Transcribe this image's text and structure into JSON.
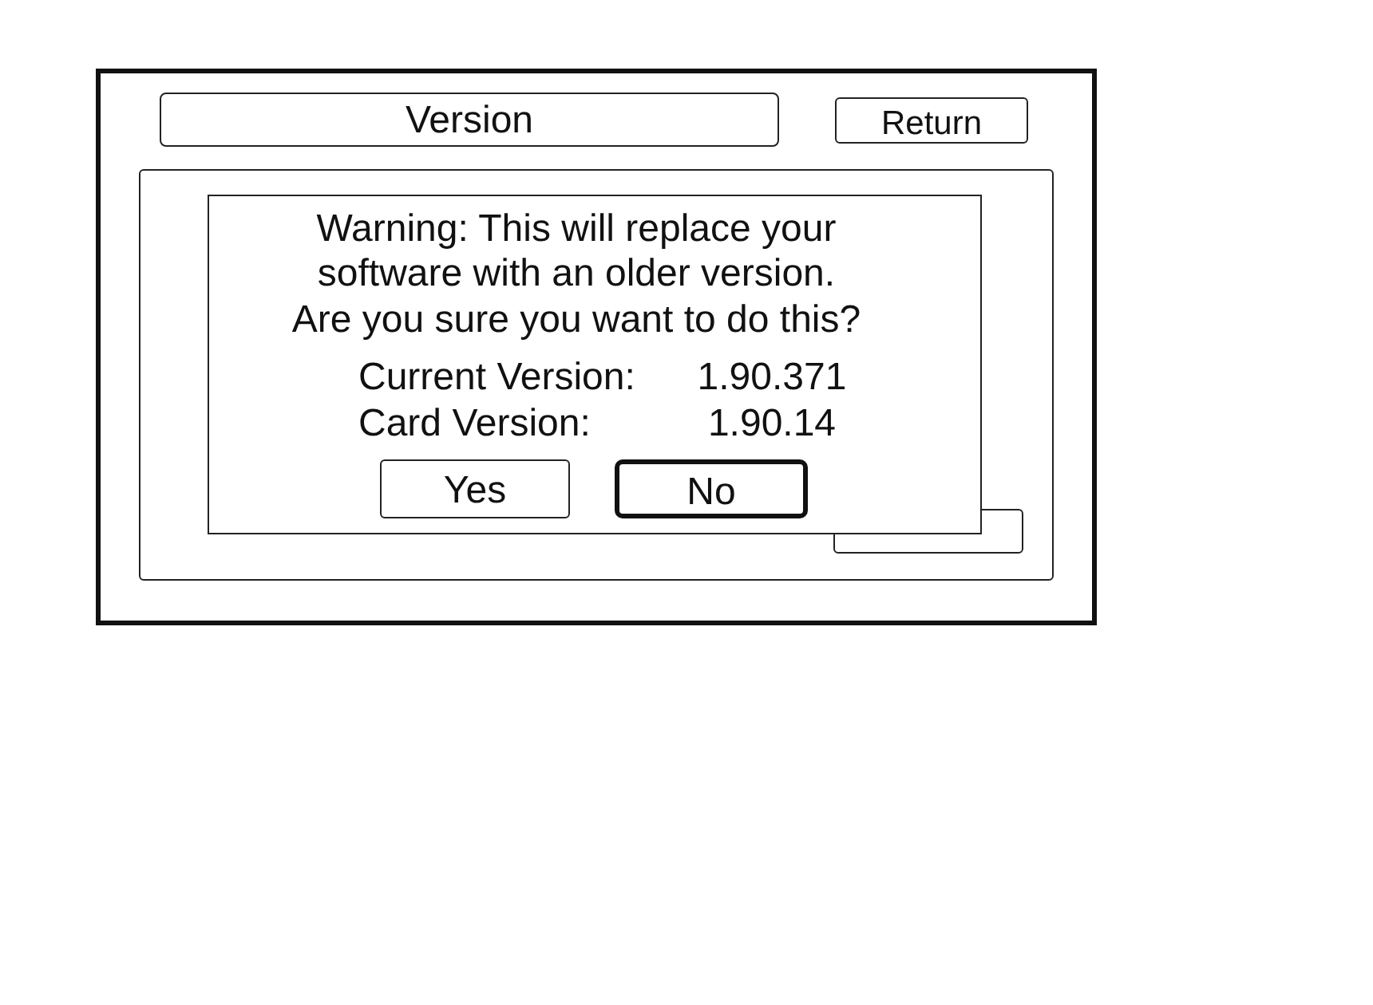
{
  "header": {
    "title": "Version",
    "return_button": "Return"
  },
  "dialog": {
    "message": [
      "Warning: This will replace your",
      "software with an older version.",
      "Are you sure you want to do this?"
    ],
    "versions": [
      {
        "label": "Current Version:",
        "value": "1.90.371"
      },
      {
        "label": "Card Version:",
        "value": "1.90.14"
      }
    ],
    "buttons": [
      {
        "label": "Yes",
        "selected": false
      },
      {
        "label": "No",
        "selected": true
      }
    ]
  }
}
